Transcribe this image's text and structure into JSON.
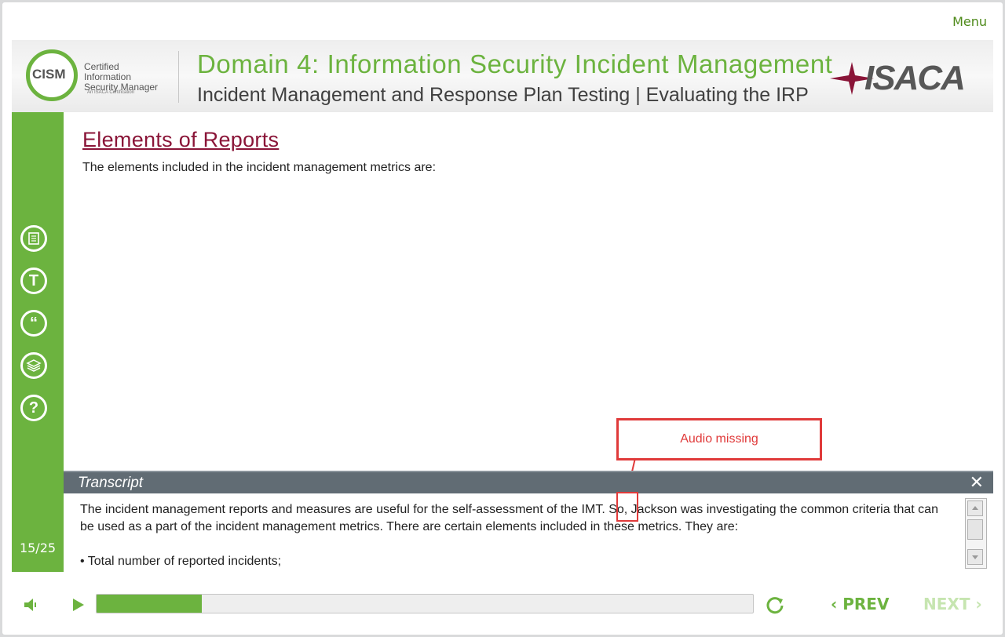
{
  "menu_label": "Menu",
  "header": {
    "logo_text_line1": "Certified Information",
    "logo_text_line2": "Security Manager",
    "logo_abbrev": "CISM",
    "logo_sub": "An ISACA Certification",
    "domain_title": "Domain 4: Information Security Incident Management",
    "domain_subtitle": "Incident Management and Response Plan Testing | Evaluating the IRP",
    "brand": "ISACA"
  },
  "sidebar": {
    "icons": [
      "notes-icon",
      "transcript-icon",
      "quote-icon",
      "layers-icon",
      "help-icon"
    ],
    "page_number": "15/25"
  },
  "content": {
    "title": "Elements of Reports",
    "text": "The elements included in the incident management metrics are:"
  },
  "annotation": {
    "label": "Audio missing"
  },
  "transcript": {
    "title": "Transcript",
    "text": "The incident management reports and measures are useful for the self-assessment of the IMT. So, Jackson was investigating the common criteria that can be used as a part of the incident management metrics. There are certain elements included in these metrics. They are:",
    "bullet": "•  Total number of reported incidents;"
  },
  "controls": {
    "progress_percent": 16,
    "prev_label": "PREV",
    "next_label": "NEXT"
  },
  "colors": {
    "accent_green": "#6cb33f",
    "title_maroon": "#8a1538",
    "annotation_red": "#e03a3a"
  }
}
